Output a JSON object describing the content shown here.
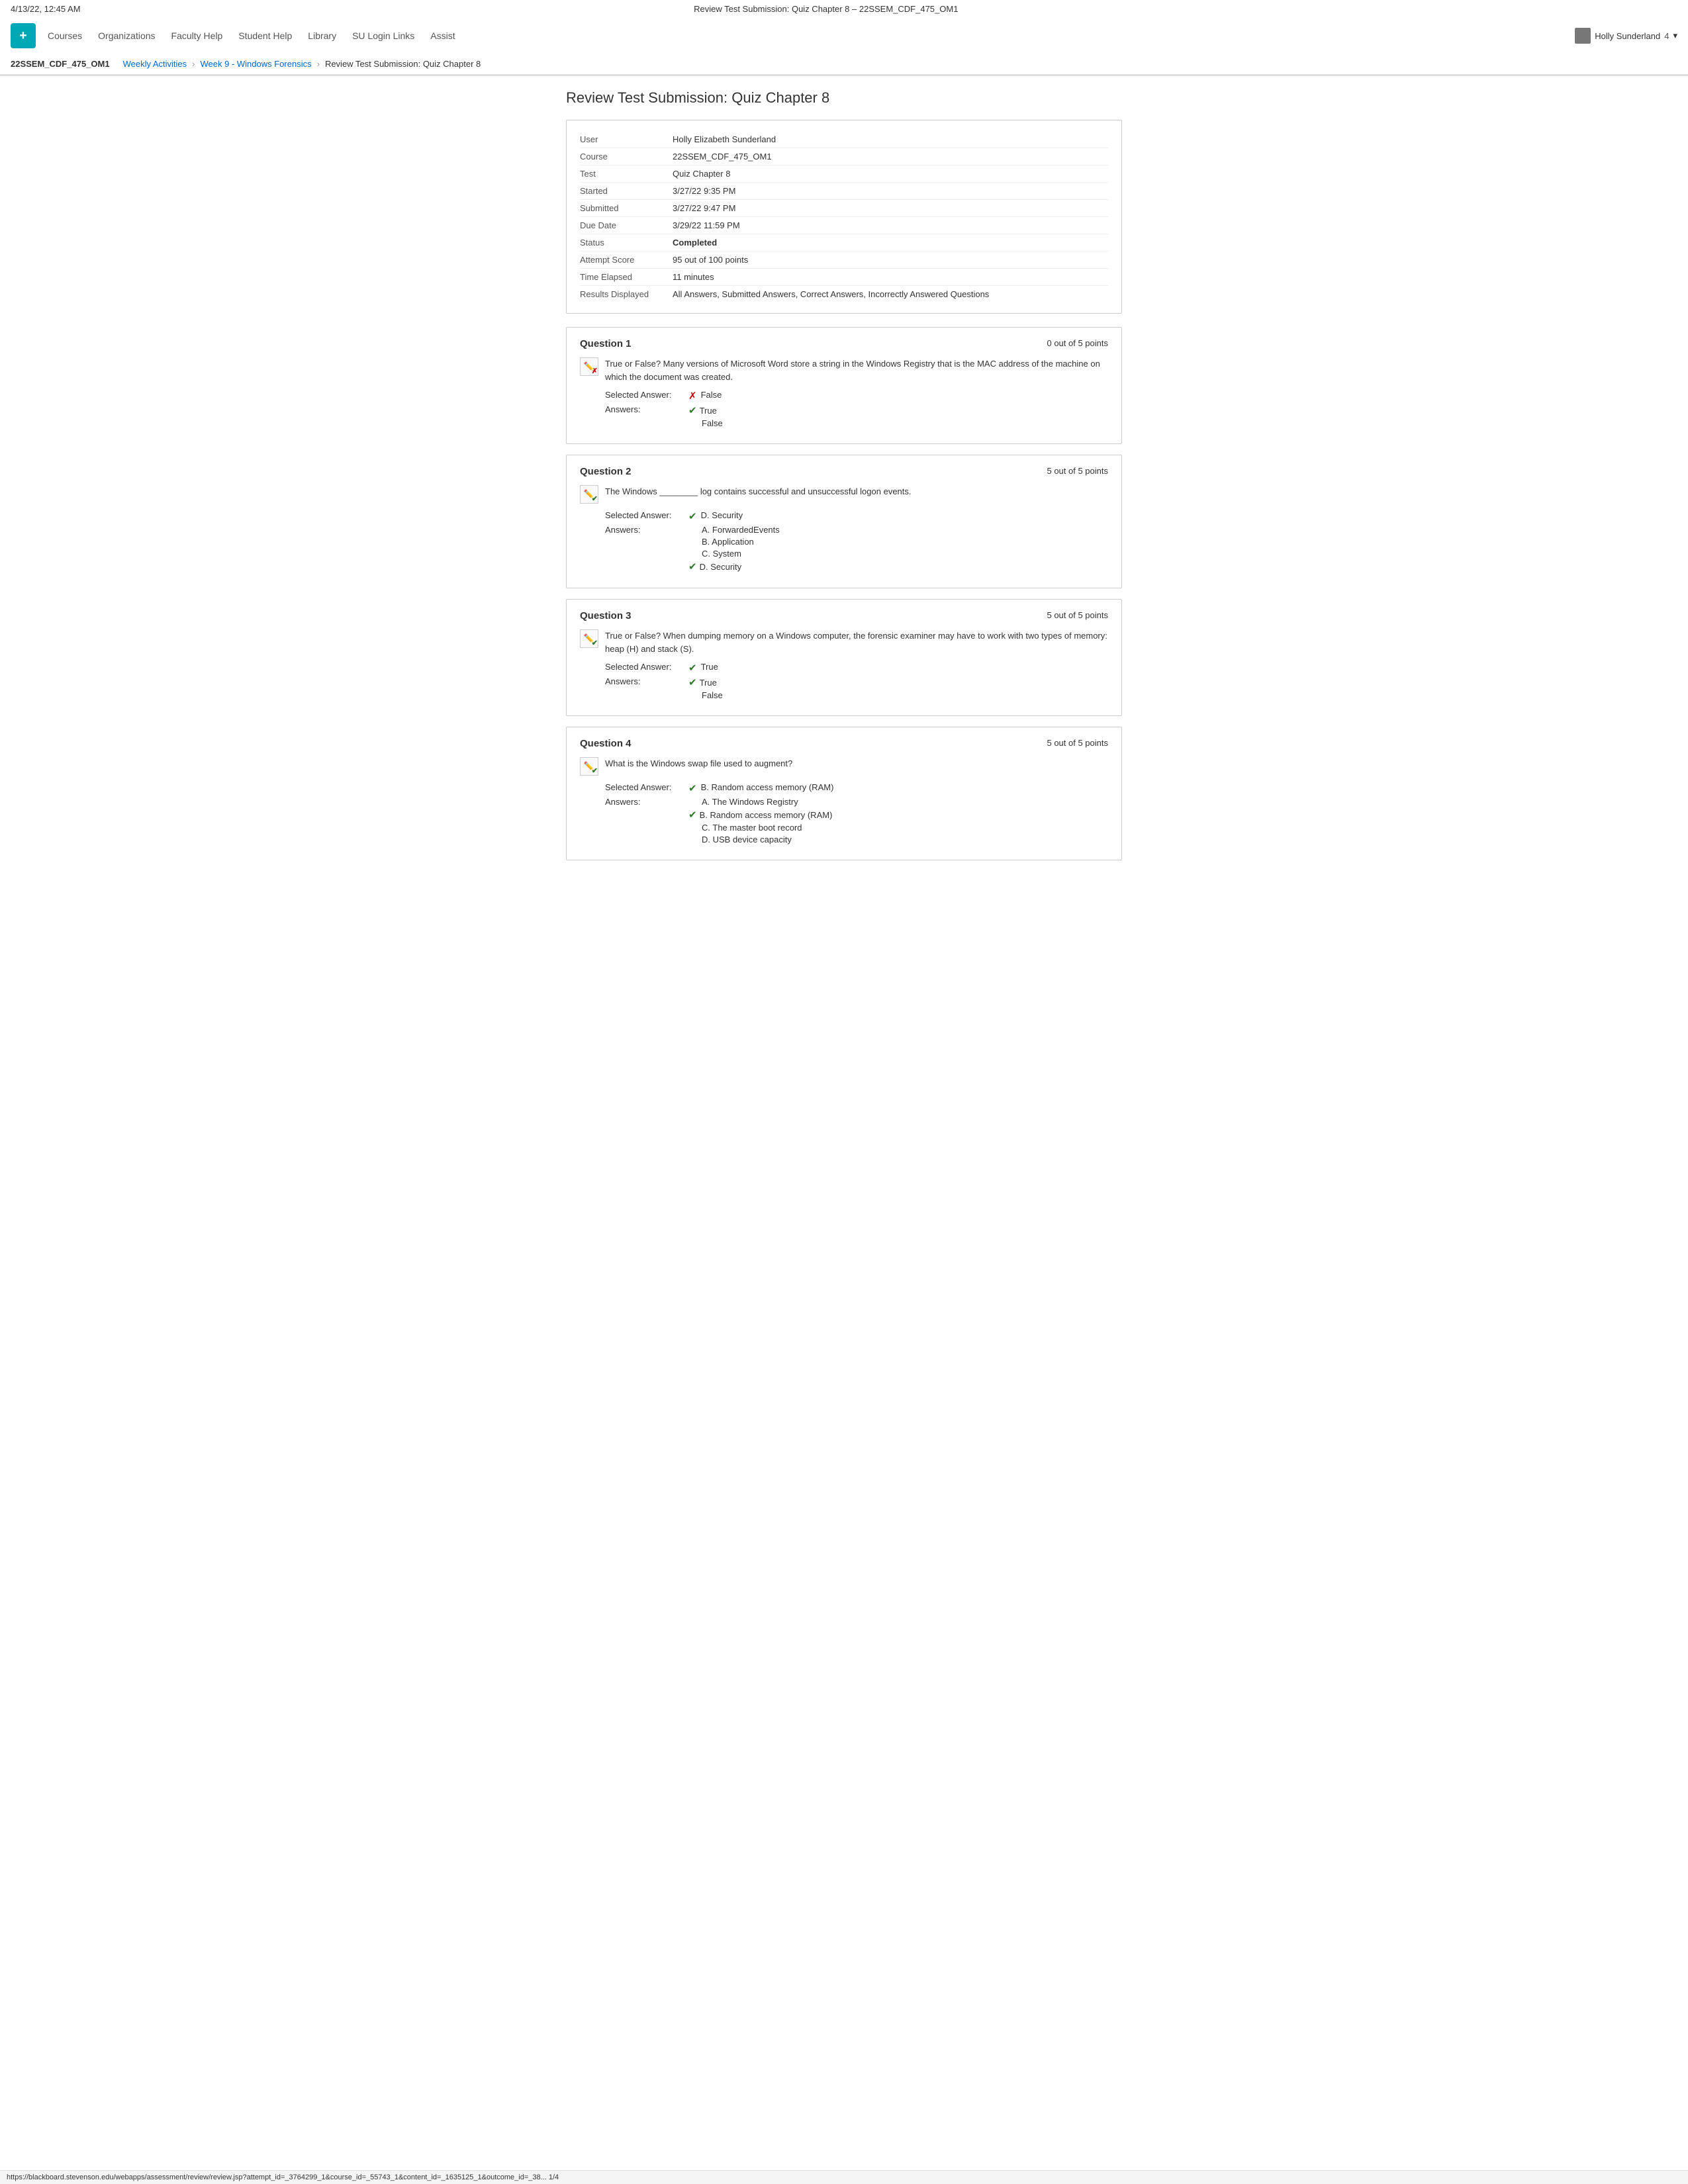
{
  "browser": {
    "date_time": "4/13/22, 12:45 AM",
    "page_title": "Review Test Submission: Quiz Chapter 8 – 22SSEM_CDF_475_OM1"
  },
  "nav": {
    "logo_letter": "+",
    "links": [
      {
        "label": "Courses",
        "id": "courses"
      },
      {
        "label": "Organizations",
        "id": "organizations"
      },
      {
        "label": "Faculty Help",
        "id": "faculty-help"
      },
      {
        "label": "Student Help",
        "id": "student-help"
      },
      {
        "label": "Library",
        "id": "library"
      },
      {
        "label": "SU Login Links",
        "id": "su-login"
      },
      {
        "label": "Assist",
        "id": "assist"
      }
    ],
    "user_name": "Holly Sunderland",
    "user_number": "4"
  },
  "breadcrumb": {
    "course": "22SSEM_CDF_475_OM1",
    "items": [
      {
        "label": "Weekly Activities",
        "id": "weekly-activities"
      },
      {
        "label": "Week 9 - Windows Forensics",
        "id": "week9"
      },
      {
        "label": "Review Test Submission: Quiz Chapter 8",
        "id": "review"
      }
    ]
  },
  "page_heading": "Review Test Submission: Quiz Chapter 8",
  "submission_info": [
    {
      "label": "User",
      "value": "Holly Elizabeth Sunderland",
      "bold": false
    },
    {
      "label": "Course",
      "value": "22SSEM_CDF_475_OM1",
      "bold": false
    },
    {
      "label": "Test",
      "value": "Quiz Chapter 8",
      "bold": false
    },
    {
      "label": "Started",
      "value": "3/27/22 9:35 PM",
      "bold": false
    },
    {
      "label": "Submitted",
      "value": "3/27/22 9:47 PM",
      "bold": false
    },
    {
      "label": "Due Date",
      "value": "3/29/22 11:59 PM",
      "bold": false
    },
    {
      "label": "Status",
      "value": "Completed",
      "bold": true
    },
    {
      "label": "Attempt Score",
      "value": "95 out of 100 points",
      "bold": false
    },
    {
      "label": "Time Elapsed",
      "value": "11 minutes",
      "bold": false
    },
    {
      "label": "Results Displayed",
      "value": "All Answers, Submitted Answers, Correct Answers, Incorrectly Answered Questions",
      "bold": false
    }
  ],
  "questions": [
    {
      "id": 1,
      "title": "Question 1",
      "points_label": "0 out of 5 points",
      "correct": false,
      "icon_type": "wrong",
      "text": "True or False? Many versions of Microsoft Word store a string in the Windows Registry that is the MAC address of the machine on which the document was created.",
      "selected_answer_prefix": "Selected Answer:",
      "selected_answer_icon": "incorrect",
      "selected_answer": "False",
      "answers_label": "Answers:",
      "answers": [
        {
          "icon": "correct",
          "text": "True"
        },
        {
          "icon": "none",
          "text": "False"
        }
      ]
    },
    {
      "id": 2,
      "title": "Question 2",
      "points_label": "5 out of 5 points",
      "correct": true,
      "icon_type": "correct",
      "text": "The Windows ________ log contains successful and unsuccessful logon events.",
      "selected_answer_prefix": "Selected Answer:",
      "selected_answer_icon": "correct",
      "selected_answer": "D. Security",
      "answers_label": "Answers:",
      "answers": [
        {
          "icon": "none",
          "text": "A. ForwardedEvents"
        },
        {
          "icon": "none",
          "text": "B. Application"
        },
        {
          "icon": "none",
          "text": "C. System"
        },
        {
          "icon": "correct",
          "text": "D. Security"
        }
      ]
    },
    {
      "id": 3,
      "title": "Question 3",
      "points_label": "5 out of 5 points",
      "correct": true,
      "icon_type": "correct",
      "text": "True or False? When dumping memory on a Windows computer, the forensic examiner may have to work with two types of memory: heap (H) and stack (S).",
      "selected_answer_prefix": "Selected Answer:",
      "selected_answer_icon": "correct",
      "selected_answer": "True",
      "answers_label": "Answers:",
      "answers": [
        {
          "icon": "correct",
          "text": "True"
        },
        {
          "icon": "none",
          "text": "False"
        }
      ]
    },
    {
      "id": 4,
      "title": "Question 4",
      "points_label": "5 out of 5 points",
      "correct": true,
      "icon_type": "correct",
      "text": "What is the Windows swap file used to augment?",
      "selected_answer_prefix": "Selected Answer:",
      "selected_answer_icon": "correct",
      "selected_answer": "B. Random access memory (RAM)",
      "answers_label": "Answers:",
      "answers": [
        {
          "icon": "none",
          "text": "A. The Windows Registry"
        },
        {
          "icon": "correct",
          "text": "B. Random access memory (RAM)"
        },
        {
          "icon": "none",
          "text": "C. The master boot record"
        },
        {
          "icon": "none",
          "text": "D. USB device capacity"
        }
      ]
    }
  ],
  "url_bar": "https://blackboard.stevenson.edu/webapps/assessment/review/review.jsp?attempt_id=_3764299_1&course_id=_55743_1&content_id=_1635125_1&outcome_id=_38...    1/4"
}
